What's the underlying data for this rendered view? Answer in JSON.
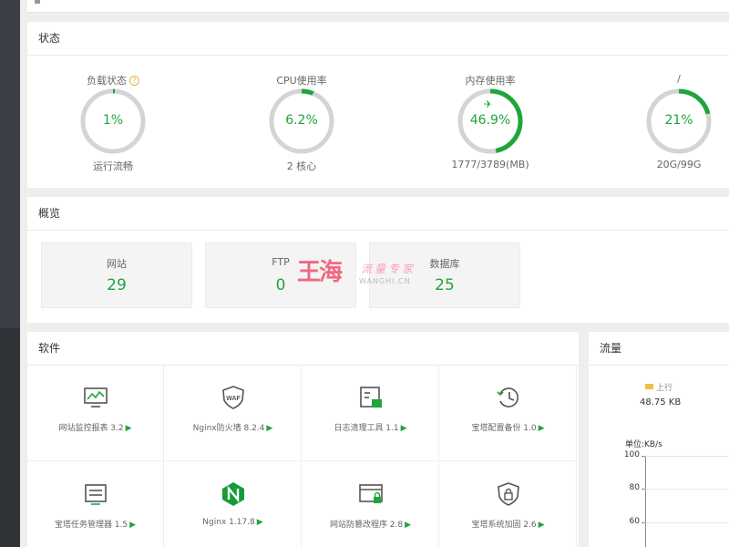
{
  "status": {
    "title": "状态",
    "gauges": [
      {
        "label": "负载状态",
        "help": "?",
        "value": "1%",
        "percent": 1,
        "sub": "运行流畅",
        "color": "#20a53a"
      },
      {
        "label": "CPU使用率",
        "value": "6.2%",
        "percent": 6.2,
        "sub": "2 核心",
        "color": "#20a53a"
      },
      {
        "label": "内存使用率",
        "value": "46.9%",
        "percent": 46.9,
        "sub": "1777/3789(MB)",
        "color": "#20a53a"
      },
      {
        "label": "/",
        "value": "21%",
        "percent": 21,
        "sub": "20G/99G",
        "color": "#20a53a"
      }
    ]
  },
  "overview": {
    "title": "概览",
    "items": [
      {
        "label": "网站",
        "value": "29"
      },
      {
        "label": "FTP",
        "value": "0"
      },
      {
        "label": "数据库",
        "value": "25"
      }
    ],
    "watermark": {
      "big": "王海",
      "small": "流量专家",
      "en": "WANGHI.CN"
    }
  },
  "software": {
    "title": "软件",
    "play_glyph": "▶",
    "items": [
      {
        "label": "网站监控报表 3.2",
        "icon": "monitor-chart-icon"
      },
      {
        "label": "Nginx防火墙 8.2.4",
        "icon": "waf-shield-icon"
      },
      {
        "label": "日志清理工具 1.1",
        "icon": "log-clean-icon"
      },
      {
        "label": "宝塔配置备份 1.0",
        "icon": "clock-backup-icon"
      },
      {
        "label": "宝塔任务管理器 1.5",
        "icon": "task-list-icon"
      },
      {
        "label": "Nginx 1.17.8",
        "icon": "nginx-icon"
      },
      {
        "label": "网站防篡改程序 2.8",
        "icon": "web-lock-icon"
      },
      {
        "label": "宝塔系统加固 2.6",
        "icon": "shield-lock-icon"
      }
    ]
  },
  "traffic": {
    "title": "流量",
    "up_label": "上行",
    "up_value": "48.75 KB",
    "unit": "单位:KB/s",
    "yticks": [
      "100",
      "80",
      "60"
    ]
  }
}
